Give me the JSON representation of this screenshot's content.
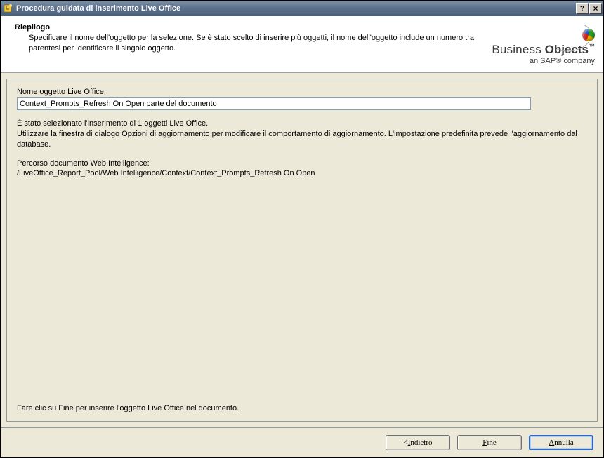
{
  "titlebar": {
    "title": "Procedura guidata di inserimento Live Office",
    "help_symbol": "?",
    "close_symbol": "×"
  },
  "header": {
    "title": "Riepilogo",
    "subtitle": "Specificare il nome dell'oggetto per la selezione. Se è stato scelto di inserire più oggetti, il nome dell'oggetto include un numero tra parentesi per identificare il singolo oggetto."
  },
  "brand": {
    "name1": "Business",
    "name2": "Objects",
    "tm": "™",
    "sub": "an SAP® company"
  },
  "form": {
    "label_prefix": "Nome oggetto Live ",
    "label_uchar": "O",
    "label_suffix": "ffice:",
    "value": "Context_Prompts_Refresh On Open parte del documento"
  },
  "info": {
    "selection": "È stato selezionato l'inserimento di 1 oggetti Live Office.\nUtilizzare la finestra di dialogo Opzioni di aggiornamento per modificare il comportamento di aggiornamento. L'impostazione predefinita prevede l'aggiornamento dal database.",
    "path_label": "Percorso documento Web Intelligence:",
    "path_value": "/LiveOffice_Report_Pool/Web Intelligence/Context/Context_Prompts_Refresh On Open"
  },
  "hint": "Fare clic su Fine per inserire l'oggetto Live Office nel documento.",
  "buttons": {
    "back_prefix": "< ",
    "back_uchar": "I",
    "back_suffix": "ndietro",
    "finish_prefix": "",
    "finish_uchar": "F",
    "finish_suffix": "ine",
    "cancel_prefix": "",
    "cancel_uchar": "A",
    "cancel_suffix": "nnulla"
  }
}
